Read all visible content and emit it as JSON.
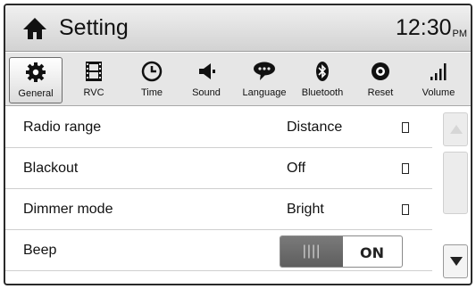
{
  "header": {
    "title": "Setting",
    "clock": "12:30",
    "ampm": "PM",
    "home_icon": "home-icon"
  },
  "tabs": [
    {
      "label": "General",
      "icon": "gear-icon",
      "active": true
    },
    {
      "label": "RVC",
      "icon": "film-icon",
      "active": false
    },
    {
      "label": "Time",
      "icon": "clock-icon",
      "active": false
    },
    {
      "label": "Sound",
      "icon": "speaker-icon",
      "active": false
    },
    {
      "label": "Language",
      "icon": "speech-bubble-icon",
      "active": false
    },
    {
      "label": "Bluetooth",
      "icon": "bluetooth-icon",
      "active": false
    },
    {
      "label": "Reset",
      "icon": "reset-icon",
      "active": false
    },
    {
      "label": "Volume",
      "icon": "volume-bars-icon",
      "active": false
    }
  ],
  "settings": [
    {
      "label": "Radio range",
      "value": "Distance"
    },
    {
      "label": "Blackout",
      "value": "Off"
    },
    {
      "label": "Dimmer mode",
      "value": "Bright"
    },
    {
      "label": "Beep",
      "toggle_off_text": "||||",
      "toggle_on_text": "ON",
      "state": "on"
    }
  ],
  "colors": {
    "header_top": "#f0f0f0",
    "header_bottom": "#d2d2d2",
    "tabbar": "#e6e6e6",
    "toggle_knob": "#666666"
  }
}
